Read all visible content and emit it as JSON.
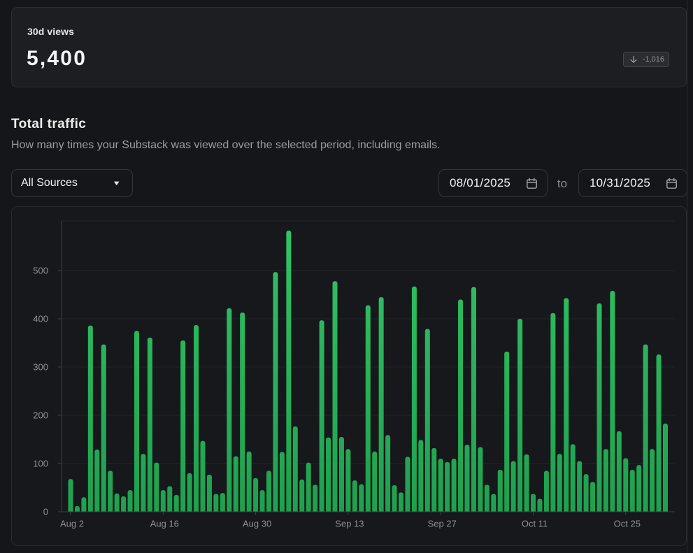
{
  "stat_card": {
    "label": "30d views",
    "value": "5,400",
    "delta_icon": "arrow-down-icon",
    "delta_text": "-1,016"
  },
  "traffic_section": {
    "title": "Total traffic",
    "subtitle": "How many times your Substack was viewed over the selected period, including emails."
  },
  "controls": {
    "source_filter_value": "All Sources",
    "chevron_icon": "chevron-down-icon",
    "date_start_value": "08/01/2025",
    "range_separator": "to",
    "date_end_value": "10/31/2025",
    "calendar_icon": "calendar-icon"
  },
  "chart_data": {
    "type": "bar",
    "title": "Total traffic",
    "xlabel": "",
    "ylabel": "",
    "categories": [
      "Aug 2",
      "Aug 3",
      "Aug 4",
      "Aug 5",
      "Aug 6",
      "Aug 7",
      "Aug 8",
      "Aug 9",
      "Aug 10",
      "Aug 11",
      "Aug 12",
      "Aug 13",
      "Aug 14",
      "Aug 15",
      "Aug 16",
      "Aug 17",
      "Aug 18",
      "Aug 19",
      "Aug 20",
      "Aug 21",
      "Aug 22",
      "Aug 23",
      "Aug 24",
      "Aug 25",
      "Aug 26",
      "Aug 27",
      "Aug 28",
      "Aug 29",
      "Aug 30",
      "Aug 31",
      "Sep 1",
      "Sep 2",
      "Sep 3",
      "Sep 4",
      "Sep 5",
      "Sep 6",
      "Sep 7",
      "Sep 8",
      "Sep 9",
      "Sep 10",
      "Sep 11",
      "Sep 12",
      "Sep 13",
      "Sep 14",
      "Sep 15",
      "Sep 16",
      "Sep 17",
      "Sep 18",
      "Sep 19",
      "Sep 20",
      "Sep 21",
      "Sep 22",
      "Sep 23",
      "Sep 24",
      "Sep 25",
      "Sep 26",
      "Sep 27",
      "Sep 28",
      "Sep 29",
      "Sep 30",
      "Oct 1",
      "Oct 2",
      "Oct 3",
      "Oct 4",
      "Oct 5",
      "Oct 6",
      "Oct 7",
      "Oct 8",
      "Oct 9",
      "Oct 10",
      "Oct 11",
      "Oct 12",
      "Oct 13",
      "Oct 14",
      "Oct 15",
      "Oct 16",
      "Oct 17",
      "Oct 18",
      "Oct 19",
      "Oct 20",
      "Oct 21",
      "Oct 22",
      "Oct 23",
      "Oct 24",
      "Oct 25",
      "Oct 26",
      "Oct 27",
      "Oct 28",
      "Oct 29",
      "Oct 30",
      "Oct 31"
    ],
    "values": [
      68,
      12,
      30,
      386,
      129,
      347,
      85,
      38,
      32,
      45,
      375,
      120,
      361,
      102,
      45,
      53,
      35,
      355,
      80,
      387,
      147,
      77,
      37,
      39,
      422,
      115,
      413,
      125,
      70,
      45,
      85,
      497,
      124,
      583,
      177,
      67,
      102,
      56,
      397,
      154,
      478,
      155,
      130,
      65,
      57,
      428,
      125,
      445,
      159,
      55,
      40,
      114,
      467,
      149,
      379,
      132,
      110,
      103,
      110,
      440,
      139,
      466,
      134,
      56,
      37,
      87,
      332,
      105,
      400,
      119,
      37,
      27,
      85,
      412,
      120,
      443,
      140,
      105,
      78,
      62,
      432,
      130,
      458,
      167,
      111,
      87,
      97,
      347,
      130,
      326,
      183
    ],
    "y_ticks": [
      0,
      100,
      200,
      300,
      400,
      500
    ],
    "ylim": [
      0,
      603
    ],
    "x_tick_indices": [
      0,
      14,
      28,
      42,
      56,
      70,
      84
    ],
    "x_tick_labels": [
      "Aug 2",
      "Aug 16",
      "Aug 30",
      "Sep 13",
      "Sep 27",
      "Oct 11",
      "Oct 25"
    ],
    "grid": true,
    "legend": false,
    "bar_color_top": "#33c465",
    "bar_color_bottom": "#1fa04e",
    "grid_color": "#222428",
    "axis_color": "#3d3f43",
    "tick_label_color": "#8e9196"
  }
}
